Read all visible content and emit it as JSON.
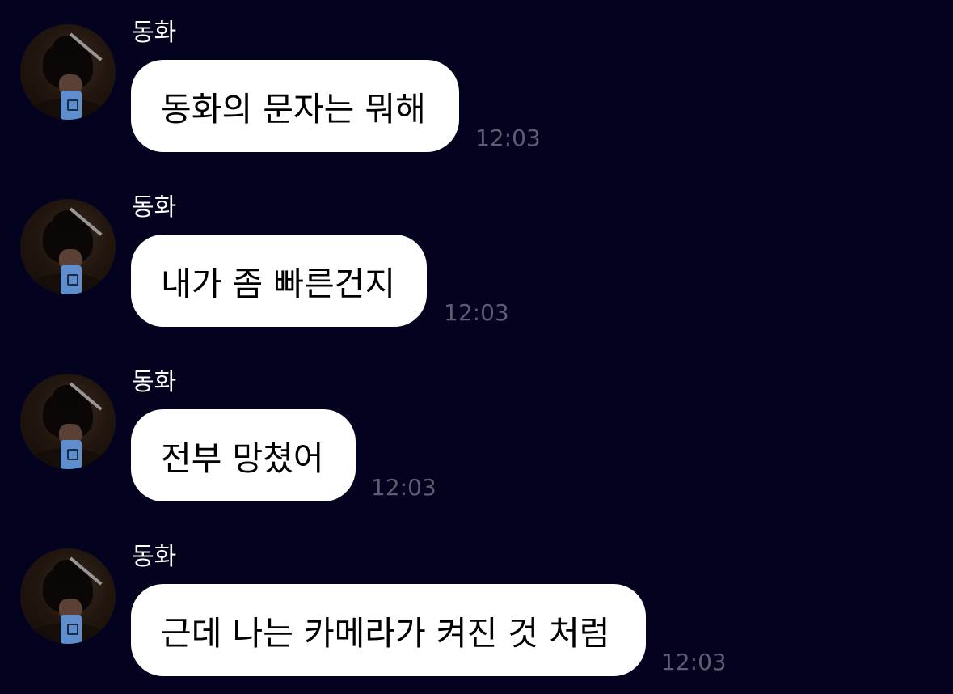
{
  "messages": [
    {
      "sender": "동화",
      "text": "동화의 문자는 뭐해",
      "time": "12:03"
    },
    {
      "sender": "동화",
      "text": "내가 좀 빠른건지",
      "time": "12:03"
    },
    {
      "sender": "동화",
      "text": "전부 망쳤어",
      "time": "12:03"
    },
    {
      "sender": "동화",
      "text": "근데 나는 카메라가 켜진 것 처럼",
      "time": "12:03"
    }
  ]
}
